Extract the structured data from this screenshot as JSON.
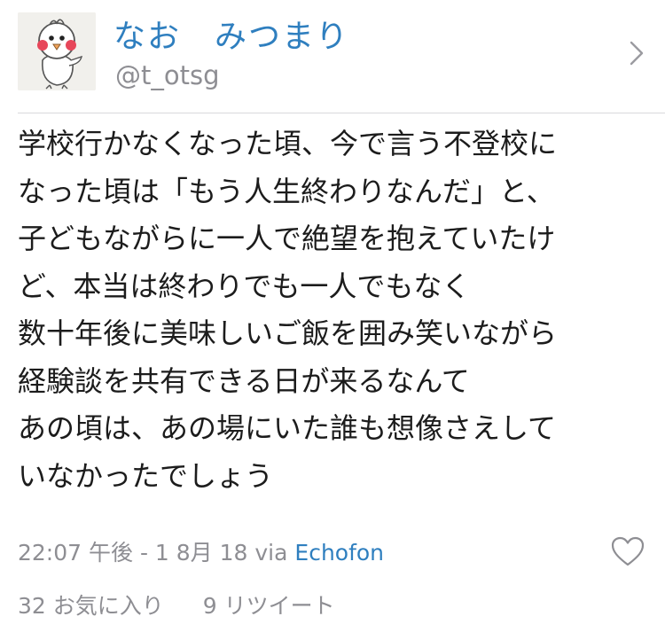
{
  "user": {
    "display_name": "なお　みつまり",
    "screen_name": "@t_otsg",
    "avatar_icon": "chick-mascot-avatar"
  },
  "tweet": {
    "lines": [
      "学校行かなくなった頃、今で言う不登校に",
      "なった頃は「もう人生終わりなんだ」と、",
      "子どもながらに一人で絶望を抱えていたけ",
      "ど、本当は終わりでも一人でもなく",
      "数十年後に美味しいご飯を囲み笑いながら",
      "経験談を共有できる日が来るなんて",
      "あの頃は、あの場にいた誰も想像さえして",
      "いなかったでしょう"
    ]
  },
  "meta": {
    "timestamp": "22:07 午後 - 1 8月 18",
    "via_label": "via",
    "via_app": "Echofon"
  },
  "stats": {
    "favorites": "32 お気に入り",
    "retweets": "9 リツイート"
  },
  "icons": {
    "chevron": "chevron-right-icon",
    "like": "heart-outline-icon"
  },
  "colors": {
    "accent": "#2f7fbf",
    "muted": "#8e8e93",
    "text": "#1c1c1c"
  }
}
